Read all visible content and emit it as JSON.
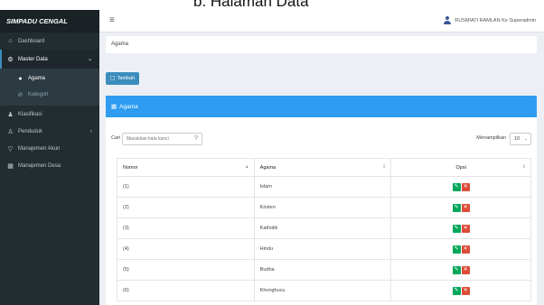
{
  "caption": "b. Halaman Data",
  "brand": "SIMPADU CENGAL",
  "nav": {
    "dashboard": "Dashboard",
    "master_data": "Master Data",
    "sub": [
      "Agama",
      "Kategori"
    ],
    "klasifikasi": "Klasifikasi",
    "penduduk": "Penduduk",
    "manajemen_akun": "Manajemen Akun",
    "manajemen_desa": "Manajemen Desa"
  },
  "topbar": {
    "user_label": "RUSMIATI RAMLAN Ke Superadmin"
  },
  "breadcrumb": "Agama",
  "tambah_label": "Tambah",
  "box_title": "Agama",
  "search": {
    "label": "Cari",
    "placeholder": "Masukkan kata kunci"
  },
  "show": {
    "label": "Menampilkan",
    "value": "10"
  },
  "table": {
    "headers": [
      "Nomor",
      "Agama",
      "Opsi"
    ],
    "rows": [
      {
        "no": "(1)",
        "agama": "Islam"
      },
      {
        "no": "(2)",
        "agama": "Kristen"
      },
      {
        "no": "(3)",
        "agama": "Katholik"
      },
      {
        "no": "(4)",
        "agama": "Hindu"
      },
      {
        "no": "(5)",
        "agama": "Budha"
      },
      {
        "no": "(6)",
        "agama": "Khonghucu"
      }
    ]
  },
  "colors": {
    "sidebar": "#222d32",
    "accent": "#2e9cf0",
    "edit": "#00a65a",
    "delete": "#dd4b39"
  },
  "icons": {
    "dashboard": "home-icon",
    "master_data": "gear-icon",
    "agama": "dot-icon",
    "kategori": "tag-icon",
    "klasifikasi": "sitemap-icon",
    "penduduk": "users-icon",
    "manajemen_akun": "filter-icon",
    "manajemen_desa": "building-icon"
  }
}
